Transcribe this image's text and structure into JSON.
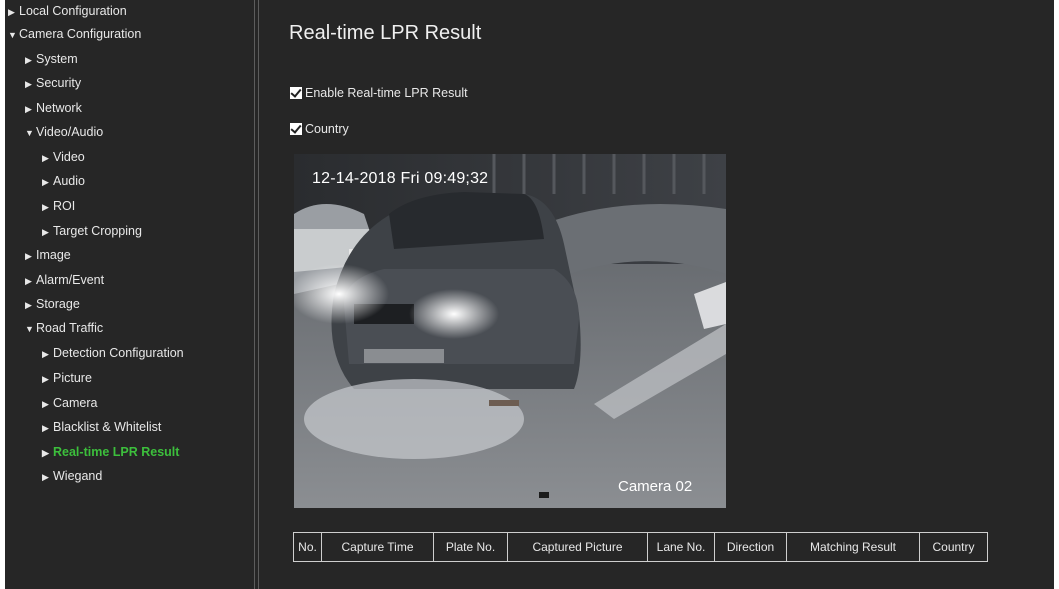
{
  "sidebar": {
    "items": [
      {
        "label": "Local Configuration",
        "arrow": "▶"
      },
      {
        "label": "Camera Configuration",
        "arrow": "▼"
      },
      {
        "label": "System",
        "arrow": "▶"
      },
      {
        "label": "Security",
        "arrow": "▶"
      },
      {
        "label": "Network",
        "arrow": "▶"
      },
      {
        "label": "Video/Audio",
        "arrow": "▼"
      },
      {
        "label": "Video",
        "arrow": "▶"
      },
      {
        "label": "Audio",
        "arrow": "▶"
      },
      {
        "label": "ROI",
        "arrow": "▶"
      },
      {
        "label": "Target Cropping",
        "arrow": "▶"
      },
      {
        "label": "Image",
        "arrow": "▶"
      },
      {
        "label": "Alarm/Event",
        "arrow": "▶"
      },
      {
        "label": "Storage",
        "arrow": "▶"
      },
      {
        "label": "Road Traffic",
        "arrow": "▼"
      },
      {
        "label": "Detection Configuration",
        "arrow": "▶"
      },
      {
        "label": "Picture",
        "arrow": "▶"
      },
      {
        "label": "Camera",
        "arrow": "▶"
      },
      {
        "label": "Blacklist & Whitelist",
        "arrow": "▶"
      },
      {
        "label": "Real-time LPR Result",
        "arrow": "▶"
      },
      {
        "label": "Wiegand",
        "arrow": "▶"
      }
    ],
    "active_color": "#3cbf3c"
  },
  "main": {
    "title": "Real-time LPR Result",
    "enable_label": "Enable Real-time LPR Result",
    "enable_checked": true,
    "country_label": "Country",
    "country_checked": true
  },
  "video": {
    "timestamp": "12-14-2018  Fri  09:49;32",
    "camera_name": "Camera 02"
  },
  "table": {
    "headers": [
      "No.",
      "Capture Time",
      "Plate No.",
      "Captured Picture",
      "Lane No.",
      "Direction",
      "Matching Result",
      "Country"
    ]
  }
}
